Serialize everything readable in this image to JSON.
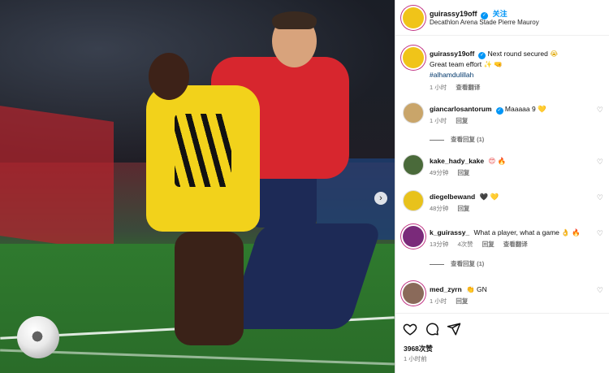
{
  "header": {
    "username": "guirassy19off",
    "follow_label": "关注",
    "location": "Decathlon Arena Stade Pierre Mauroy"
  },
  "caption": {
    "username": "guirassy19off",
    "line1": "Next round secured",
    "line1_emoji": "😭",
    "line2": "Great team effort",
    "line2_emoji": "✨ 🤜",
    "hashtag": "#alhamdulillah",
    "time": "1 小时",
    "translate": "查看翻译"
  },
  "comments": [
    {
      "username": "giancarlosantorum",
      "verified": true,
      "text": "Maaaaa 9",
      "emoji": "💛",
      "time": "1 小时",
      "reply": "回复",
      "view_replies": "查看回复 (1)"
    },
    {
      "username": "kake_hady_kake",
      "text": "",
      "emoji": "😍 🔥",
      "time": "49分钟",
      "reply": "回复"
    },
    {
      "username": "diegelbewand",
      "text": "",
      "emoji": "🖤 💛",
      "time": "48分钟",
      "reply": "回复"
    },
    {
      "username": "k_guirassy_",
      "text": "What a player, what a game",
      "emoji": "👌 🔥",
      "time": "13分钟",
      "likes": "4次赞",
      "reply": "回复",
      "translate": "查看翻译",
      "view_replies": "查看回复 (1)"
    },
    {
      "username": "med_zyrn",
      "text": "GN",
      "emoji": "👏",
      "time": "1 小时",
      "reply": "回复"
    }
  ],
  "footer": {
    "likes": "3968次赞",
    "date": "1 小时前"
  },
  "icons": {
    "like": "heart-icon",
    "comment": "comment-icon",
    "share": "share-icon",
    "next": "chevron-right-icon"
  }
}
